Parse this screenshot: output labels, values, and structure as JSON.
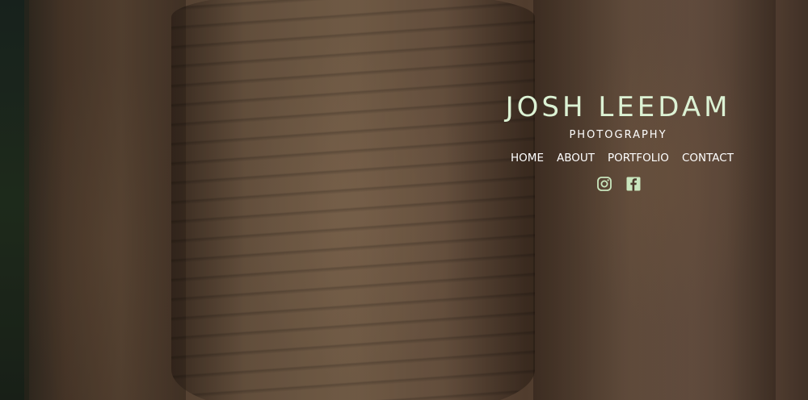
{
  "site": {
    "title": "JOSH LEEDAM",
    "subtitle": "PHOTOGRAPHY"
  },
  "nav": {
    "items": [
      {
        "label": "HOME"
      },
      {
        "label": "ABOUT"
      },
      {
        "label": "PORTFOLIO"
      },
      {
        "label": "CONTACT"
      }
    ]
  },
  "social": {
    "icons": [
      "instagram-icon",
      "facebook-icon"
    ]
  },
  "colors": {
    "title": "#dcf2d4",
    "nav_text": "#ffffff",
    "icon": "#c9e6be"
  }
}
